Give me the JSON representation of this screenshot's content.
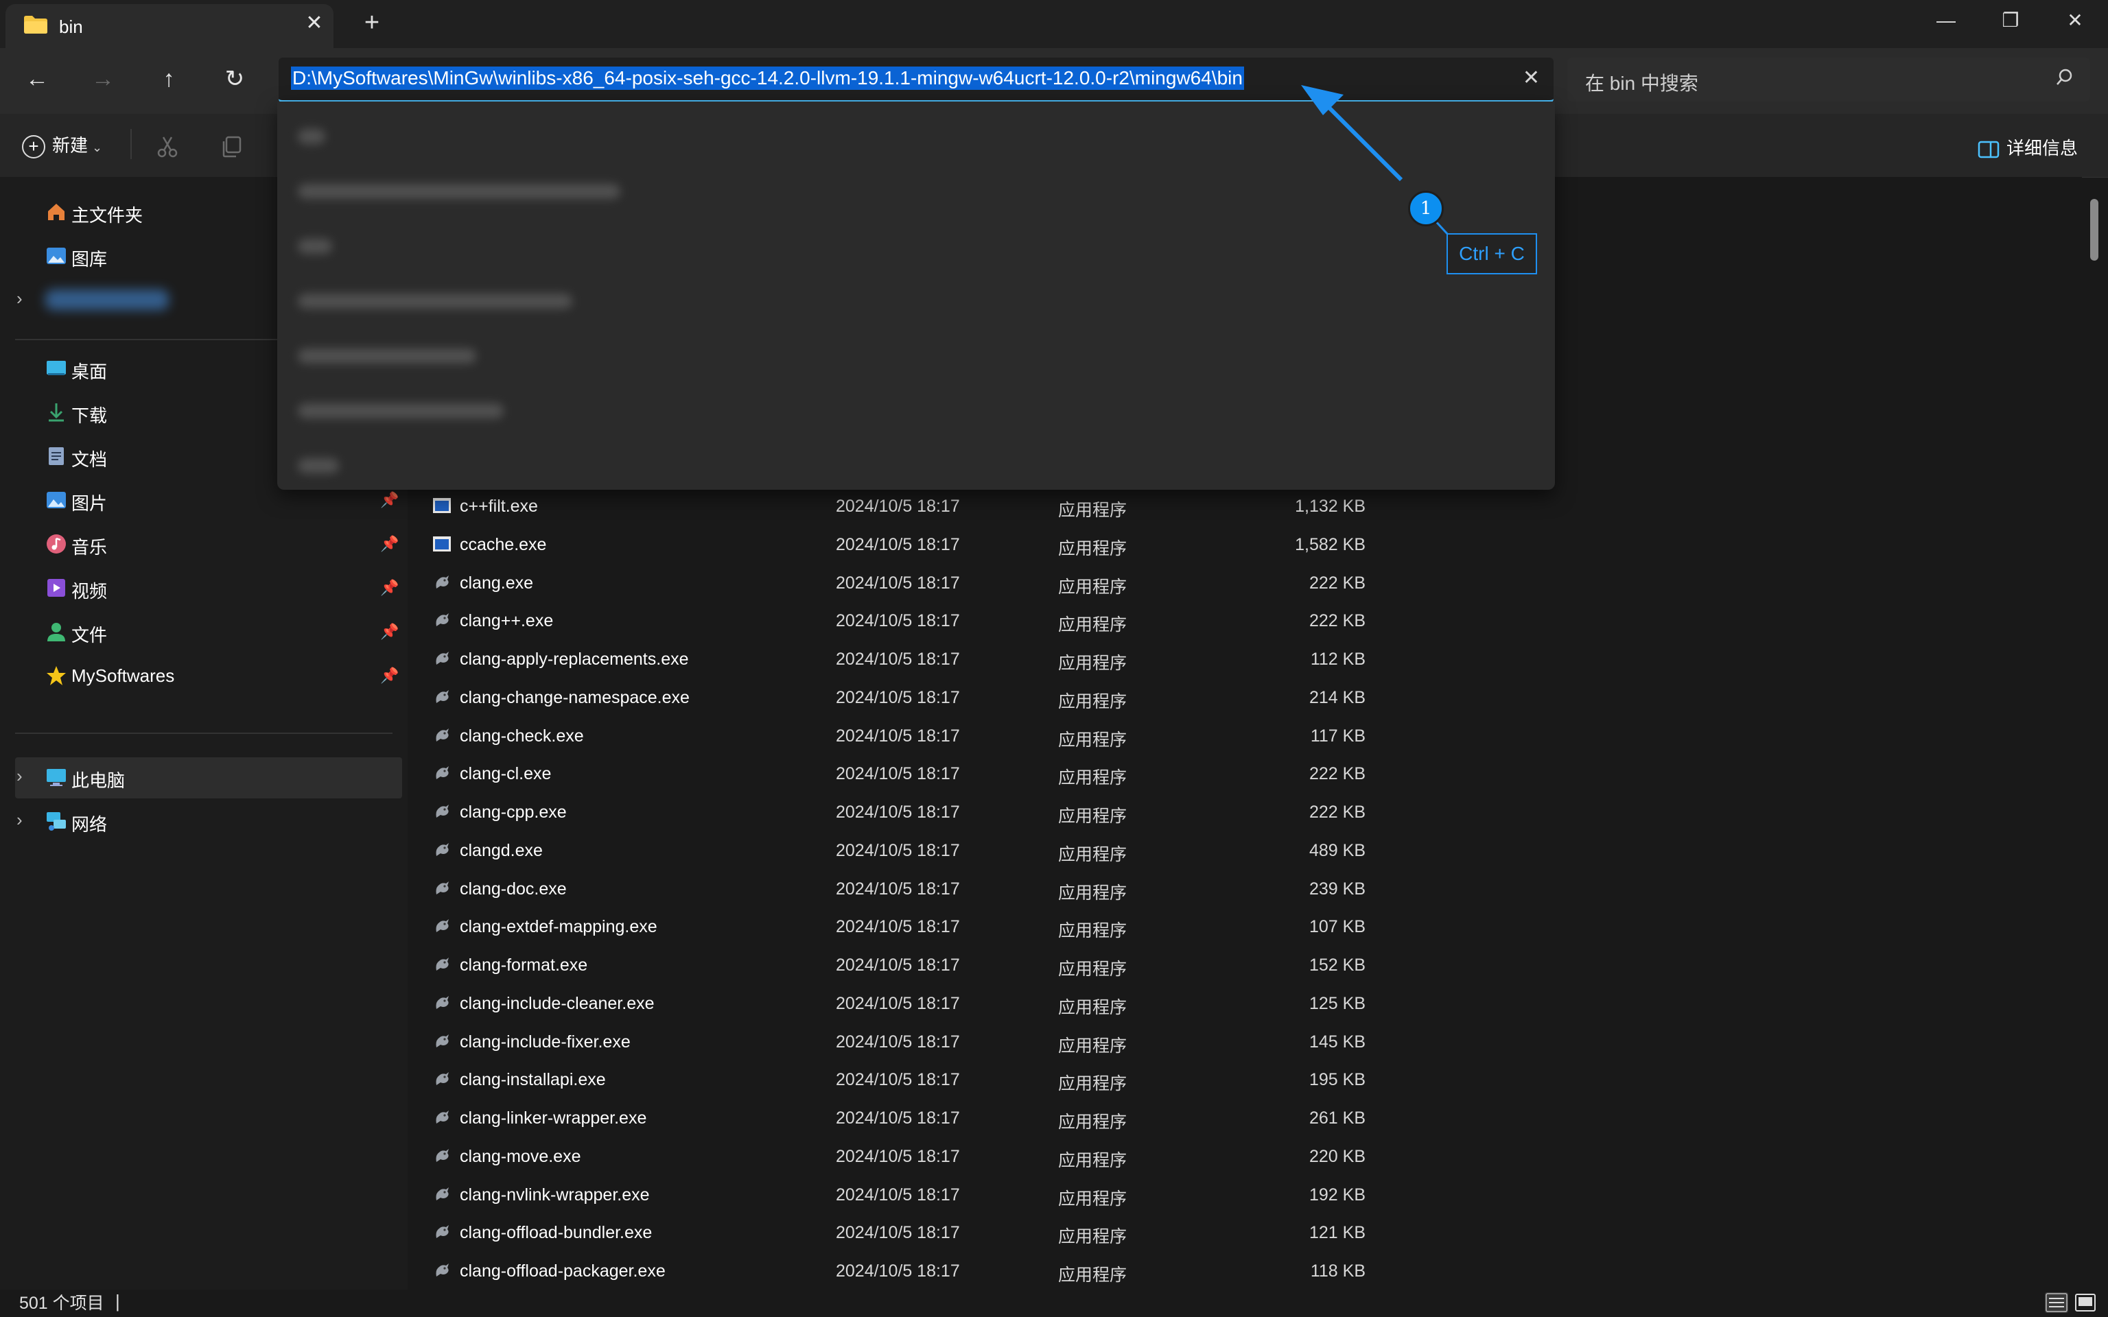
{
  "window": {
    "tab_title": "bin",
    "tab_close": "✕",
    "new_tab": "+",
    "minimize": "—",
    "restore": "❐",
    "close": "✕"
  },
  "nav": {
    "back": "←",
    "forward": "→",
    "up": "↑",
    "refresh": "↻",
    "address_value": "D:\\MySoftwares\\MinGw\\winlibs-x86_64-posix-seh-gcc-14.2.0-llvm-19.1.1-mingw-w64ucrt-12.0.0-r2\\mingw64\\bin",
    "address_clear": "✕",
    "search_placeholder": "在 bin 中搜索"
  },
  "toolbar": {
    "new_label": "新建",
    "details_label": "详细信息",
    "cut_icon": "scissors-icon",
    "copy_icon": "copy-icon"
  },
  "sidebar": {
    "quick": [
      {
        "label": "主文件夹",
        "icon": "home-icon",
        "color": "#e8813a"
      },
      {
        "label": "图库",
        "icon": "gallery-icon",
        "color": "#3a8de0"
      }
    ],
    "pinned": [
      {
        "label": "桌面",
        "icon": "desktop-icon",
        "color": "#3ab5e6",
        "pinned": false
      },
      {
        "label": "下载",
        "icon": "download-icon",
        "color": "#3aa36f",
        "pinned": false
      },
      {
        "label": "文档",
        "icon": "document-icon",
        "color": "#8fa6c9",
        "pinned": false
      },
      {
        "label": "图片",
        "icon": "pictures-icon",
        "color": "#3a8de0",
        "pinned": true
      },
      {
        "label": "音乐",
        "icon": "music-icon",
        "color": "#e0607a",
        "pinned": true
      },
      {
        "label": "视频",
        "icon": "video-icon",
        "color": "#8a4fd8",
        "pinned": true
      },
      {
        "label": "文件",
        "icon": "person-icon",
        "color": "#3fb873",
        "pinned": true
      },
      {
        "label": "MySoftwares",
        "icon": "star-icon",
        "color": "#f5c518",
        "pinned": true
      }
    ],
    "locations": [
      {
        "label": "此电脑",
        "icon": "pc-icon",
        "color": "#3ab5e6",
        "selected": true
      },
      {
        "label": "网络",
        "icon": "network-icon",
        "color": "#3ab5e6",
        "selected": false
      }
    ]
  },
  "files": [
    {
      "name": "c++filt.exe",
      "date": "2024/10/5 18:17",
      "type": "应用程序",
      "size": "1,132 KB",
      "icon": "app-window-icon"
    },
    {
      "name": "ccache.exe",
      "date": "2024/10/5 18:17",
      "type": "应用程序",
      "size": "1,582 KB",
      "icon": "app-window-icon"
    },
    {
      "name": "clang.exe",
      "date": "2024/10/5 18:17",
      "type": "应用程序",
      "size": "222 KB",
      "icon": "llvm-dragon-icon"
    },
    {
      "name": "clang++.exe",
      "date": "2024/10/5 18:17",
      "type": "应用程序",
      "size": "222 KB",
      "icon": "llvm-dragon-icon"
    },
    {
      "name": "clang-apply-replacements.exe",
      "date": "2024/10/5 18:17",
      "type": "应用程序",
      "size": "112 KB",
      "icon": "llvm-dragon-icon"
    },
    {
      "name": "clang-change-namespace.exe",
      "date": "2024/10/5 18:17",
      "type": "应用程序",
      "size": "214 KB",
      "icon": "llvm-dragon-icon"
    },
    {
      "name": "clang-check.exe",
      "date": "2024/10/5 18:17",
      "type": "应用程序",
      "size": "117 KB",
      "icon": "llvm-dragon-icon"
    },
    {
      "name": "clang-cl.exe",
      "date": "2024/10/5 18:17",
      "type": "应用程序",
      "size": "222 KB",
      "icon": "llvm-dragon-icon"
    },
    {
      "name": "clang-cpp.exe",
      "date": "2024/10/5 18:17",
      "type": "应用程序",
      "size": "222 KB",
      "icon": "llvm-dragon-icon"
    },
    {
      "name": "clangd.exe",
      "date": "2024/10/5 18:17",
      "type": "应用程序",
      "size": "489 KB",
      "icon": "llvm-dragon-icon"
    },
    {
      "name": "clang-doc.exe",
      "date": "2024/10/5 18:17",
      "type": "应用程序",
      "size": "239 KB",
      "icon": "llvm-dragon-icon"
    },
    {
      "name": "clang-extdef-mapping.exe",
      "date": "2024/10/5 18:17",
      "type": "应用程序",
      "size": "107 KB",
      "icon": "llvm-dragon-icon"
    },
    {
      "name": "clang-format.exe",
      "date": "2024/10/5 18:17",
      "type": "应用程序",
      "size": "152 KB",
      "icon": "llvm-dragon-icon"
    },
    {
      "name": "clang-include-cleaner.exe",
      "date": "2024/10/5 18:17",
      "type": "应用程序",
      "size": "125 KB",
      "icon": "llvm-dragon-icon"
    },
    {
      "name": "clang-include-fixer.exe",
      "date": "2024/10/5 18:17",
      "type": "应用程序",
      "size": "145 KB",
      "icon": "llvm-dragon-icon"
    },
    {
      "name": "clang-installapi.exe",
      "date": "2024/10/5 18:17",
      "type": "应用程序",
      "size": "195 KB",
      "icon": "llvm-dragon-icon"
    },
    {
      "name": "clang-linker-wrapper.exe",
      "date": "2024/10/5 18:17",
      "type": "应用程序",
      "size": "261 KB",
      "icon": "llvm-dragon-icon"
    },
    {
      "name": "clang-move.exe",
      "date": "2024/10/5 18:17",
      "type": "应用程序",
      "size": "220 KB",
      "icon": "llvm-dragon-icon"
    },
    {
      "name": "clang-nvlink-wrapper.exe",
      "date": "2024/10/5 18:17",
      "type": "应用程序",
      "size": "192 KB",
      "icon": "llvm-dragon-icon"
    },
    {
      "name": "clang-offload-bundler.exe",
      "date": "2024/10/5 18:17",
      "type": "应用程序",
      "size": "121 KB",
      "icon": "llvm-dragon-icon"
    },
    {
      "name": "clang-offload-packager.exe",
      "date": "2024/10/5 18:17",
      "type": "应用程序",
      "size": "118 KB",
      "icon": "llvm-dragon-icon"
    }
  ],
  "annotation": {
    "step": "1",
    "shortcut": "Ctrl + C",
    "color": "#1e8ff0"
  },
  "status": {
    "item_count": "501 个项目",
    "cursor": "|"
  },
  "colors": {
    "accent": "#4cc2ff",
    "selection": "#0a63d4"
  }
}
